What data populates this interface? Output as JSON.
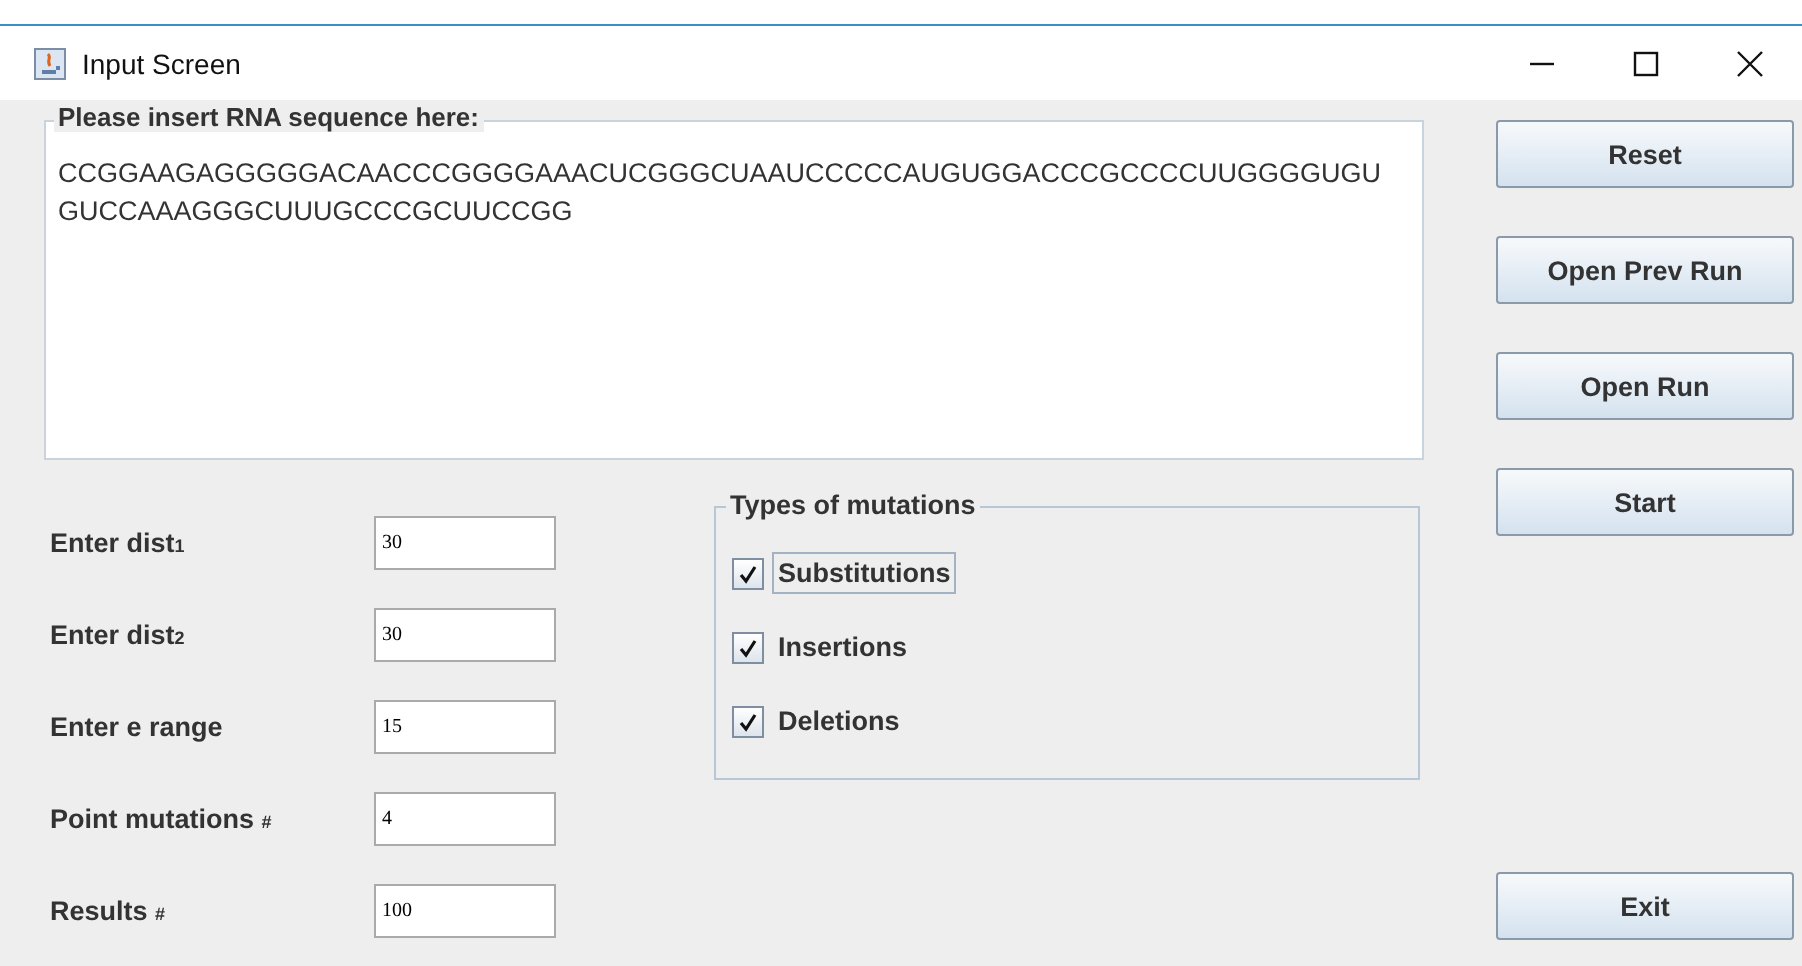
{
  "window": {
    "title": "Input Screen"
  },
  "sequence": {
    "label": "Please insert RNA sequence here:",
    "value": "CCGGAAGAGGGGGACAACCCGGGGAAACUCGGGCUAAUCCCCCAUGUGGACCCGCCCCUUGGGGUGU\nGUCCAAAGGGCUUUGCCCGCUUCCGG"
  },
  "fields": [
    {
      "label": "Enter dist$_{1}$",
      "value": "30"
    },
    {
      "label": "Enter dist$_{2}$",
      "value": "30"
    },
    {
      "label": "Enter e range",
      "value": "15"
    },
    {
      "label": "Point mutations $_{#}$",
      "value": "4"
    },
    {
      "label": "Results $_{#}$",
      "value": "100"
    }
  ],
  "mutations": {
    "title": "Types of mutations",
    "options": [
      {
        "label": "Substitutions",
        "checked": true,
        "focused": true
      },
      {
        "label": "Insertions",
        "checked": true,
        "focused": false
      },
      {
        "label": "Deletions",
        "checked": true,
        "focused": false
      }
    ]
  },
  "buttons": [
    "Reset",
    "Open Prev Run",
    "Open Run",
    "Start"
  ],
  "exit_button": "Exit"
}
